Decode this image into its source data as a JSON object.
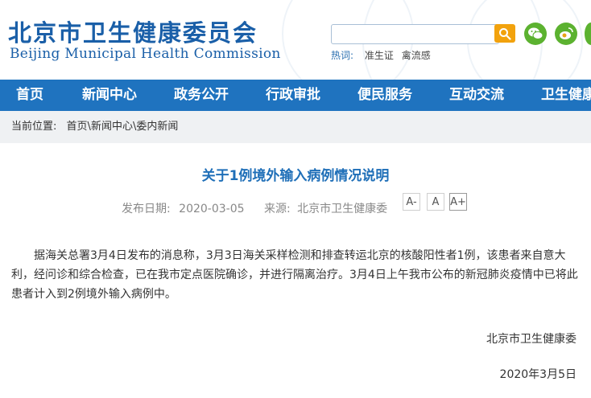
{
  "header": {
    "title_cn": "北京市卫生健康委员会",
    "title_en": "Beijing Municipal Health Commission",
    "search_placeholder": "",
    "hot_label": "热词:",
    "hot_keywords": [
      "准生证",
      "禽流感"
    ]
  },
  "nav": {
    "items": [
      "首页",
      "新闻中心",
      "政务公开",
      "行政审批",
      "便民服务",
      "互动交流",
      "卫生健康"
    ]
  },
  "breadcrumb": {
    "label": "当前位置:",
    "items": [
      "首页",
      "新闻中心",
      "委内新闻"
    ],
    "separator": "\\"
  },
  "article": {
    "title": "关于1例境外输入病例情况说明",
    "date_label": "发布日期:",
    "date_value": "2020-03-05",
    "source_label": "来源:",
    "source_value": "北京市卫生健康委",
    "font_buttons": [
      "A-",
      "A",
      "A+"
    ],
    "body": "据海关总署3月4日发布的消息称，3月3日海关采样检测和排查转运北京的核酸阳性者1例，该患者来自意大利，经问诊和综合检查，已在我市定点医院确诊，并进行隔离治疗。3月4日上午我市公布的新冠肺炎疫情中已将此患者计入到2例境外输入病例中。",
    "signature": "北京市卫生健康委",
    "sign_date": "2020年3月5日"
  },
  "colors": {
    "brand_blue": "#1a5fa8",
    "nav_blue": "#1f73bf",
    "search_orange": "#f2a20d",
    "social_green": "#5cb230"
  }
}
